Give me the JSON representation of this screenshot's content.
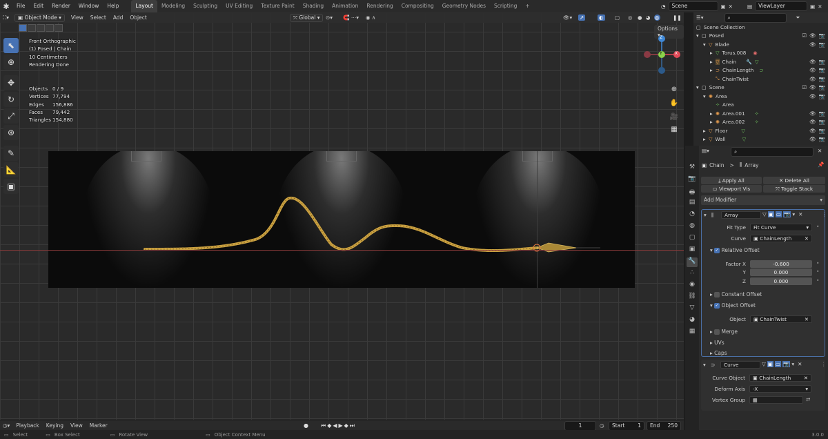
{
  "topbar": {
    "menu": [
      "File",
      "Edit",
      "Render",
      "Window",
      "Help"
    ],
    "workspaces": [
      "Layout",
      "Modeling",
      "Sculpting",
      "UV Editing",
      "Texture Paint",
      "Shading",
      "Animation",
      "Rendering",
      "Compositing",
      "Geometry Nodes",
      "Scripting"
    ],
    "add_tab": "+",
    "scene": "Scene",
    "view_layer": "ViewLayer"
  },
  "viewport_header": {
    "mode": "Object Mode",
    "menu": [
      "View",
      "Select",
      "Add",
      "Object"
    ],
    "orientation": "Global",
    "options": "Options"
  },
  "overlay": {
    "view_name": "Front Orthographic",
    "collection": "(1) Posed | Chain",
    "scale": "10 Centimeters",
    "render_status": "Rendering Done"
  },
  "stats": [
    {
      "label": "Objects",
      "value": "0 / 9"
    },
    {
      "label": "Vertices",
      "value": "77,794"
    },
    {
      "label": "Edges",
      "value": "156,886"
    },
    {
      "label": "Faces",
      "value": "79,442"
    },
    {
      "label": "Triangles",
      "value": "154,880"
    }
  ],
  "gizmo": {
    "z": "Z",
    "y": "Y",
    "x": "X"
  },
  "outliner": {
    "title": "Scene Collection",
    "rows": [
      {
        "label": "Posed",
        "indent": 1,
        "kind": "collection"
      },
      {
        "label": "Blade",
        "indent": 2,
        "kind": "mesh"
      },
      {
        "label": "Torus.008",
        "indent": 3,
        "kind": "mesh"
      },
      {
        "label": "Chain",
        "indent": 3,
        "kind": "mesh"
      },
      {
        "label": "ChainLength",
        "indent": 3,
        "kind": "curve"
      },
      {
        "label": "ChainTwist",
        "indent": 3,
        "kind": "empty"
      },
      {
        "label": "Scene",
        "indent": 1,
        "kind": "collection"
      },
      {
        "label": "Area",
        "indent": 2,
        "kind": "light"
      },
      {
        "label": "Area",
        "indent": 3,
        "kind": "lightdata"
      },
      {
        "label": "Area.001",
        "indent": 3,
        "kind": "light"
      },
      {
        "label": "Area.002",
        "indent": 3,
        "kind": "light"
      },
      {
        "label": "Floor",
        "indent": 2,
        "kind": "mesh"
      },
      {
        "label": "Wall",
        "indent": 2,
        "kind": "mesh"
      }
    ]
  },
  "properties": {
    "breadcrumb_object": "Chain",
    "breadcrumb_sep": ">",
    "breadcrumb_modifier": "Array",
    "apply_all": "Apply All",
    "delete_all": "Delete All",
    "viewport_vis": "Viewport Vis",
    "toggle_stack": "Toggle Stack",
    "add_modifier": "Add Modifier",
    "array": {
      "name": "Array",
      "fit_type_label": "Fit Type",
      "fit_type": "Fit Curve",
      "curve_label": "Curve",
      "curve": "ChainLength",
      "relative_offset": "Relative Offset",
      "factor_x_label": "Factor X",
      "factor_x": "-0.600",
      "y_label": "Y",
      "y": "0.000",
      "z_label": "Z",
      "z": "0.000",
      "constant_offset": "Constant Offset",
      "object_offset": "Object Offset",
      "object_label": "Object",
      "object": "ChainTwist",
      "merge": "Merge",
      "uvs": "UVs",
      "caps": "Caps"
    },
    "curve_mod": {
      "name": "Curve",
      "curve_object_label": "Curve Object",
      "curve_object": "ChainLength",
      "deform_axis_label": "Deform Axis",
      "deform_axis": "-X",
      "vertex_group_label": "Vertex Group",
      "vertex_group": ""
    }
  },
  "timeline": {
    "menu": [
      "Playback",
      "Keying",
      "View",
      "Marker"
    ],
    "current_frame": "1",
    "start_label": "Start",
    "start": "1",
    "end_label": "End",
    "end": "250"
  },
  "statusbar": {
    "select": "Select",
    "box_select": "Box Select",
    "rotate_view": "Rotate View",
    "context_menu": "Object Context Menu",
    "version": "3.0.0"
  },
  "colors": {
    "accent": "#4772b3",
    "chain_gold": "#c9a040",
    "x_axis": "#e04a58",
    "y_axis": "#8bd24b",
    "z_axis": "#3f88d6"
  }
}
